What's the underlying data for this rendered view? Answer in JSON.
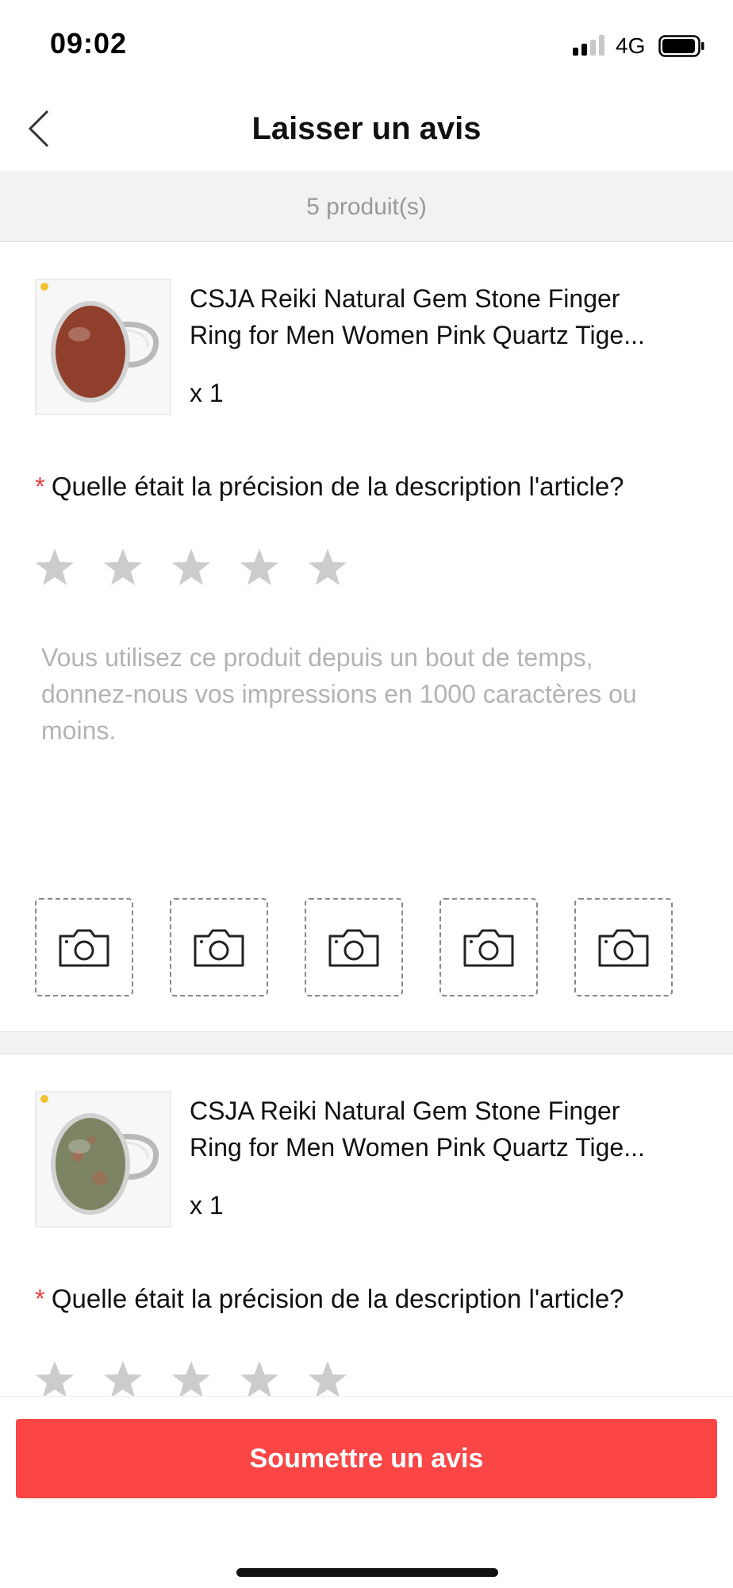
{
  "status_bar": {
    "time": "09:02",
    "network": "4G",
    "signal_level": 2,
    "battery_level": 0.85
  },
  "header": {
    "title": "Laisser un avis"
  },
  "summary": {
    "product_count_text": "5 produit(s)"
  },
  "products": [
    {
      "name_line1": "CSJA Reiki Natural Gem Stone Finger",
      "name_line2": "Ring for Men Women Pink Quartz Tige...",
      "quantity": "x 1",
      "stone_color": "#8f3f2c",
      "question_marker": "*",
      "question": "Quelle était la précision de la description l'article?",
      "rating": 0,
      "rating_max": 5,
      "review_placeholder": "Vous utilisez ce produit depuis un bout de temps, donnez-nous vos impressions en 1000 caractères ou moins.",
      "photo_slots": 5
    },
    {
      "name_line1": "CSJA Reiki Natural Gem Stone Finger",
      "name_line2": "Ring for Men Women Pink Quartz Tige...",
      "quantity": "x 1",
      "stone_color": "#7d8464",
      "question_marker": "*",
      "question": "Quelle était la précision de la description l'article?",
      "rating": 0,
      "rating_max": 5
    }
  ],
  "footer": {
    "submit_label": "Soumettre un avis"
  },
  "colors": {
    "accent": "#fc4646",
    "star_empty": "#cccccc",
    "required_marker": "#e54346"
  }
}
